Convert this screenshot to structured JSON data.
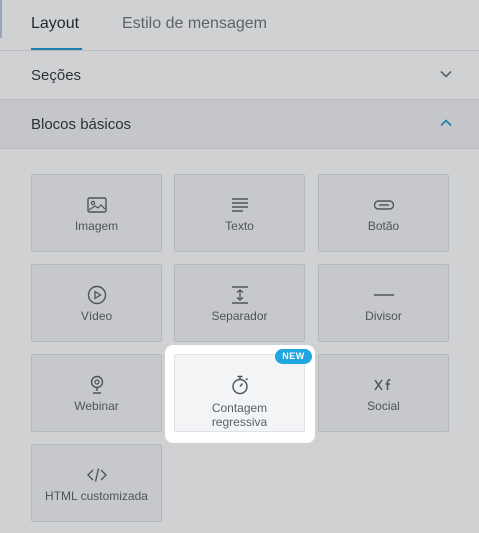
{
  "tabs": [
    {
      "label": "Layout"
    },
    {
      "label": "Estilo de mensagem"
    }
  ],
  "sections": [
    {
      "title": "Seções",
      "expanded": false
    },
    {
      "title": "Blocos básicos",
      "expanded": true
    }
  ],
  "blocks": [
    {
      "label": "Imagem",
      "icon": "image-icon"
    },
    {
      "label": "Texto",
      "icon": "text-icon"
    },
    {
      "label": "Botão",
      "icon": "button-icon"
    },
    {
      "label": "Vídeo",
      "icon": "play-icon"
    },
    {
      "label": "Separador",
      "icon": "separator-icon"
    },
    {
      "label": "Divisor",
      "icon": "divider-icon"
    },
    {
      "label": "Webinar",
      "icon": "webinar-icon"
    },
    {
      "label": "Contagem regressiva",
      "icon": "stopwatch-icon",
      "badge": "NEW"
    },
    {
      "label": "Social",
      "icon": "social-icon"
    },
    {
      "label": "HTML customizada",
      "icon": "code-icon"
    }
  ],
  "colors": {
    "accent": "#1a7fae",
    "badge": "#20a6e0",
    "overlay": "#d0d1d3"
  }
}
